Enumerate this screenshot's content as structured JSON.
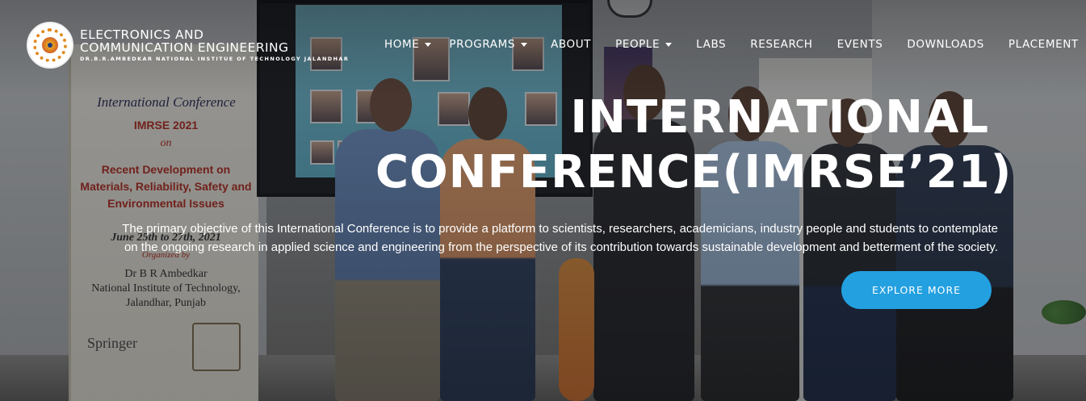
{
  "brand": {
    "line1": "ELECTRONICS AND",
    "line2": "COMMUNICATION ENGINEERING",
    "subtitle": "DR.B.R.AMBEDKAR NATIONAL INSTITUE OF TECHNOLOGY JALANDHAR",
    "logo_icon": "institute-emblem-icon"
  },
  "nav": {
    "items": [
      {
        "label": "HOME",
        "has_dropdown": true
      },
      {
        "label": "PROGRAMS",
        "has_dropdown": true
      },
      {
        "label": "ABOUT",
        "has_dropdown": false
      },
      {
        "label": "PEOPLE",
        "has_dropdown": true
      },
      {
        "label": "LABS",
        "has_dropdown": false
      },
      {
        "label": "RESEARCH",
        "has_dropdown": false
      },
      {
        "label": "EVENTS",
        "has_dropdown": false
      },
      {
        "label": "DOWNLOADS",
        "has_dropdown": false
      },
      {
        "label": "PLACEMENT",
        "has_dropdown": false
      }
    ]
  },
  "hero": {
    "title_line1": "INTERNATIONAL",
    "title_line2": "CONFERENCE(IMRSE’21)",
    "description": "The primary objective of this International Conference is to provide a platform to scientists, researchers, academicians, industry people and students to contemplate on the ongoing research in applied science and engineering from the perspective of its contribution towards sustainable development and betterment of the society.",
    "cta_label": "EXPLORE MORE"
  },
  "background_photo": {
    "banner_title": "International Conference",
    "banner_event": "IMRSE 2021",
    "banner_on": "on",
    "banner_topic": "Recent Development on Materials, Reliability, Safety and Environmental Issues",
    "banner_dates": "June 25th to 27th, 2021",
    "banner_organized": "Organized by",
    "banner_org1": "Dr B R Ambedkar",
    "banner_org2": "National Institute of Technology,",
    "banner_org3": "Jalandhar, Punjab",
    "banner_partner": "Springer"
  },
  "colors": {
    "cta_background": "#23a0e0",
    "text": "#ffffff"
  }
}
